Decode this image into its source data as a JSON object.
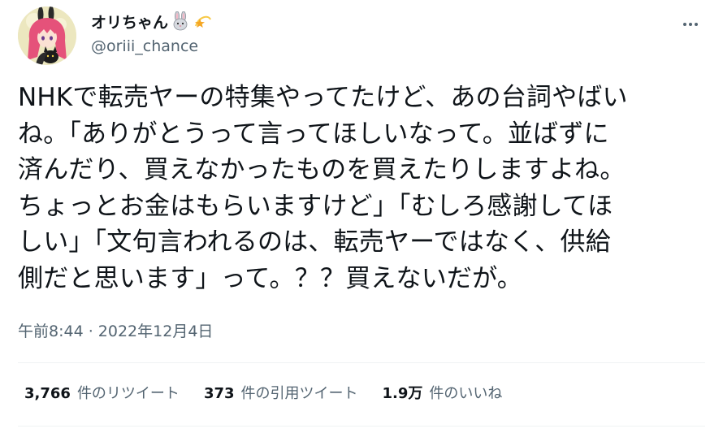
{
  "author": {
    "display_name": "オリちゃん",
    "handle": "@oriii_chance",
    "name_emojis": [
      "rabbit-face-icon",
      "dizzy-star-icon"
    ]
  },
  "tweet": {
    "lines": [
      "NHKで転売ヤーの特集やってたけど、あの台詞やばい",
      "ね。「ありがとうって言ってほしいなって。並ばずに",
      "済んだり、買えなかったものを買えたりしますよね。",
      "ちょっとお金はもらいますけど」「むしろ感謝してほ",
      "しい」「文句言われるのは、転売ヤーではなく、供給",
      "側だと思います」って。？？買えないだが。"
    ],
    "timestamp": "午前8:44 · 2022年12月4日"
  },
  "stats": {
    "retweets": {
      "count": "3,766",
      "label": "件のリツイート"
    },
    "quotes": {
      "count": "373",
      "label": "件の引用ツイート"
    },
    "likes": {
      "count": "1.9万",
      "label": "件のいいね"
    }
  },
  "icons": {
    "more": "more-dots-icon"
  }
}
